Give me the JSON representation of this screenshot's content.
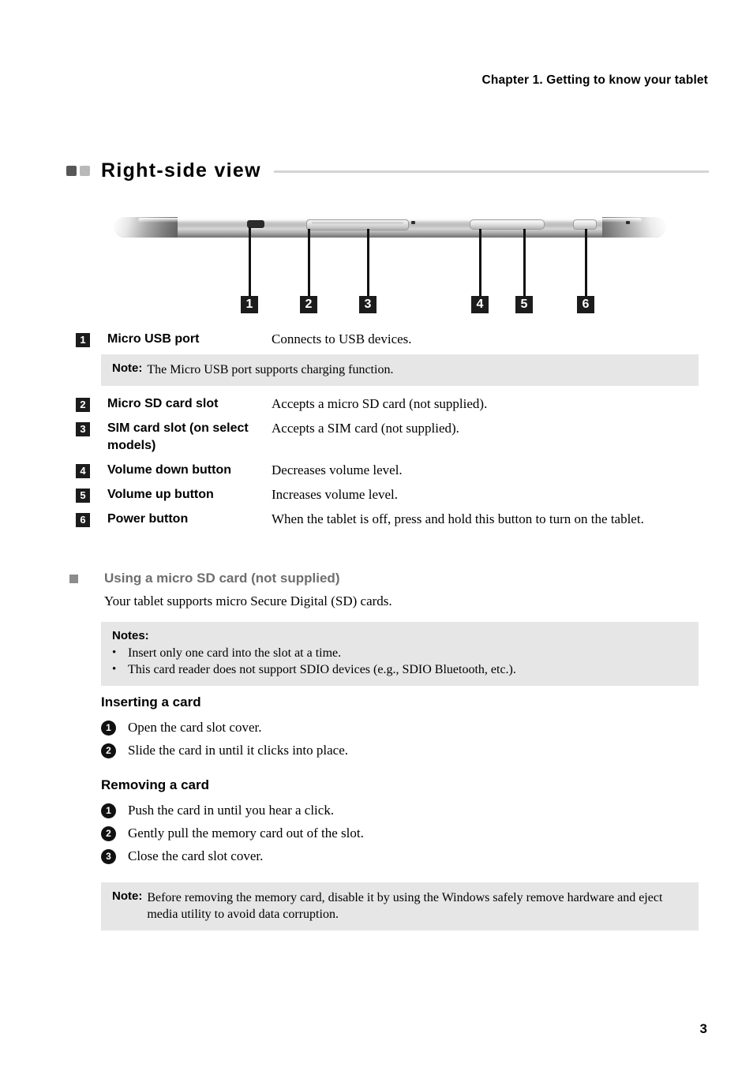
{
  "header": {
    "chapter": "Chapter 1. Getting to know your tablet"
  },
  "section": {
    "title": "Right-side view"
  },
  "figure": {
    "callouts": [
      {
        "number": "1",
        "feature": "micro-usb-port"
      },
      {
        "number": "2",
        "feature": "micro-sd-card-slot"
      },
      {
        "number": "3",
        "feature": "sim-card-slot"
      },
      {
        "number": "4",
        "feature": "volume-down-button"
      },
      {
        "number": "5",
        "feature": "volume-up-button"
      },
      {
        "number": "6",
        "feature": "power-button"
      }
    ]
  },
  "spec_list": [
    {
      "number": "1",
      "label": "Micro USB port",
      "description": "Connects to USB devices."
    },
    {
      "number": "2",
      "label": "Micro SD card slot",
      "description": "Accepts a micro SD card (not supplied)."
    },
    {
      "number": "3",
      "label": "SIM card slot (on select models)",
      "description": "Accepts a SIM card (not supplied)."
    },
    {
      "number": "4",
      "label": "Volume down button",
      "description": "Decreases volume level."
    },
    {
      "number": "5",
      "label": "Volume up button",
      "description": "Increases volume level."
    },
    {
      "number": "6",
      "label": "Power button",
      "description": "When the tablet is off, press and hold this button to turn on the tablet."
    }
  ],
  "usb_note": {
    "lead": "Note:",
    "body": "The Micro USB port supports charging function."
  },
  "subsection": {
    "title": "Using a micro SD card (not supplied)",
    "text": "Your tablet supports micro Secure Digital (SD) cards."
  },
  "notes_block": {
    "title": "Notes:",
    "bullet": "•",
    "items": [
      "Insert only one card into the slot at a time.",
      "This card reader does not support SDIO devices (e.g., SDIO Bluetooth, etc.)."
    ]
  },
  "inserting": {
    "heading": "Inserting a card",
    "steps": [
      {
        "number": "1",
        "text": "Open the card slot cover."
      },
      {
        "number": "2",
        "text": "Slide the card in until it clicks into place."
      }
    ]
  },
  "removing": {
    "heading": "Removing a card",
    "steps": [
      {
        "number": "1",
        "text": "Push the card in until you hear a click."
      },
      {
        "number": "2",
        "text": "Gently pull the memory card out of the slot."
      },
      {
        "number": "3",
        "text": "Close the card slot cover."
      }
    ]
  },
  "bottom_note": {
    "lead": "Note:",
    "body": "Before removing the memory card, disable it by using the Windows safely remove hardware and eject media utility to avoid data corruption."
  },
  "page": {
    "number": "3"
  },
  "colors": {
    "note_background": "#e6e6e6",
    "callout_box": "#1c1c1c",
    "title_square_dark": "#575757",
    "title_square_light": "#b9b9b9",
    "subsection_gray": "#6e6e6e",
    "rule": "#d4d4d4"
  }
}
